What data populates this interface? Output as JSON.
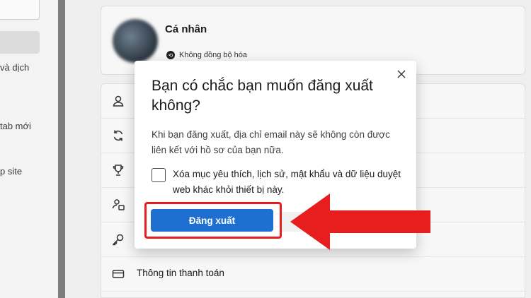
{
  "left_nav": {
    "items": [
      "và dịch",
      "tab mới",
      "p site"
    ]
  },
  "profile": {
    "name": "Cá nhân",
    "sync_status": "Không đồng bộ hóa"
  },
  "settings": {
    "payment_label": "Thông tin thanh toán"
  },
  "dialog": {
    "title": "Bạn có chắc bạn muốn đăng xuất không?",
    "body": "Khi bạn đăng xuất, địa chỉ email này sẽ không còn được liên kết với hồ sơ của bạn nữa.",
    "checkbox_label": "Xóa mục yêu thích, lịch sử, mật khẩu và dữ liệu duyệt web khác khỏi thiết bị này.",
    "checkbox_checked": false,
    "signout_label": "Đăng xuất"
  },
  "colors": {
    "primary_button": "#1f6fd0",
    "annotation_red": "#e61e1e"
  }
}
